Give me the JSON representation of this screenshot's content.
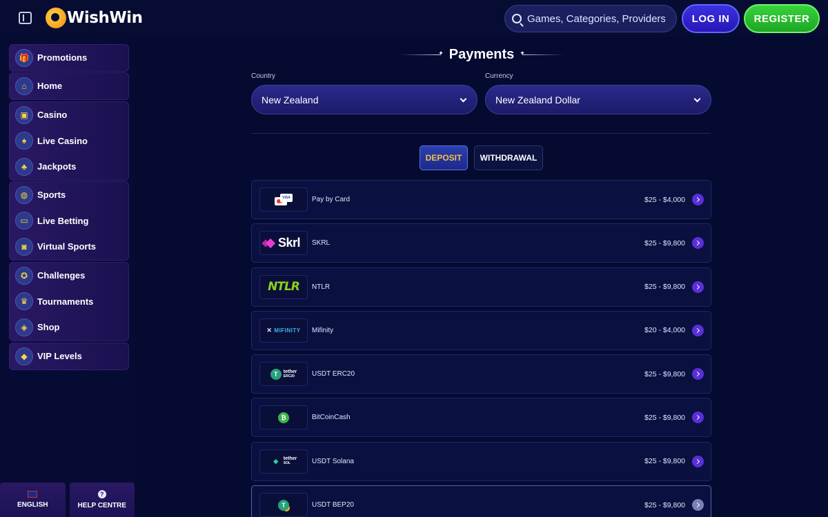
{
  "header": {
    "logo_text": "WishWin",
    "search_placeholder": "Games, Categories, Providers",
    "login_label": "LOG IN",
    "register_label": "REGISTER"
  },
  "sidebar": {
    "groups": [
      [
        {
          "label": "Promotions",
          "icon": "gift-icon"
        }
      ],
      [
        {
          "label": "Home",
          "icon": "home-icon"
        }
      ],
      [
        {
          "label": "Casino",
          "icon": "slot-machine-icon"
        },
        {
          "label": "Live Casino",
          "icon": "playing-card-icon"
        },
        {
          "label": "Jackpots",
          "icon": "clover-icon"
        }
      ],
      [
        {
          "label": "Sports",
          "icon": "basketball-icon"
        },
        {
          "label": "Live Betting",
          "icon": "live-tv-icon"
        },
        {
          "label": "Virtual Sports",
          "icon": "virtual-screen-icon"
        }
      ],
      [
        {
          "label": "Challenges",
          "icon": "medal-icon"
        },
        {
          "label": "Tournaments",
          "icon": "trophy-icon"
        },
        {
          "label": "Shop",
          "icon": "shopping-bag-icon"
        }
      ],
      [
        {
          "label": "VIP Levels",
          "icon": "diamond-icon"
        }
      ]
    ],
    "footer": {
      "language_label": "ENGLISH",
      "help_label": "HELP CENTRE"
    }
  },
  "main": {
    "title": "Payments",
    "country_label": "Country",
    "country_value": "New Zealand",
    "currency_label": "Currency",
    "currency_value": "New Zealand Dollar",
    "tabs": {
      "deposit": "DEPOSIT",
      "withdrawal": "WITHDRAWAL"
    },
    "methods": [
      {
        "name": "Pay by Card",
        "range": "$25 - $4,000",
        "logo": "card"
      },
      {
        "name": "SKRL",
        "range": "$25 - $9,800",
        "logo": "skrl",
        "logo_text": "Skrl"
      },
      {
        "name": "NTLR",
        "range": "$25 - $9,800",
        "logo": "ntlr",
        "logo_text": "NTLR"
      },
      {
        "name": "Mifinity",
        "range": "$20 - $4,000",
        "logo": "mifinity",
        "logo_text": "MIFINITY"
      },
      {
        "name": "USDT ERC20",
        "range": "$25 - $9,800",
        "logo": "tether-erc20",
        "logo_text": "tether",
        "logo_sub": "ERC20"
      },
      {
        "name": "BitCoinCash",
        "range": "$25 - $9,800",
        "logo": "bch"
      },
      {
        "name": "USDT Solana",
        "range": "$25 - $9,800",
        "logo": "tether-sol",
        "logo_text": "tether",
        "logo_sub": "SOL"
      },
      {
        "name": "USDT BEP20",
        "range": "$25 - $9,800",
        "logo": "tether-bep20"
      }
    ],
    "card_logo_text": "VISA"
  }
}
